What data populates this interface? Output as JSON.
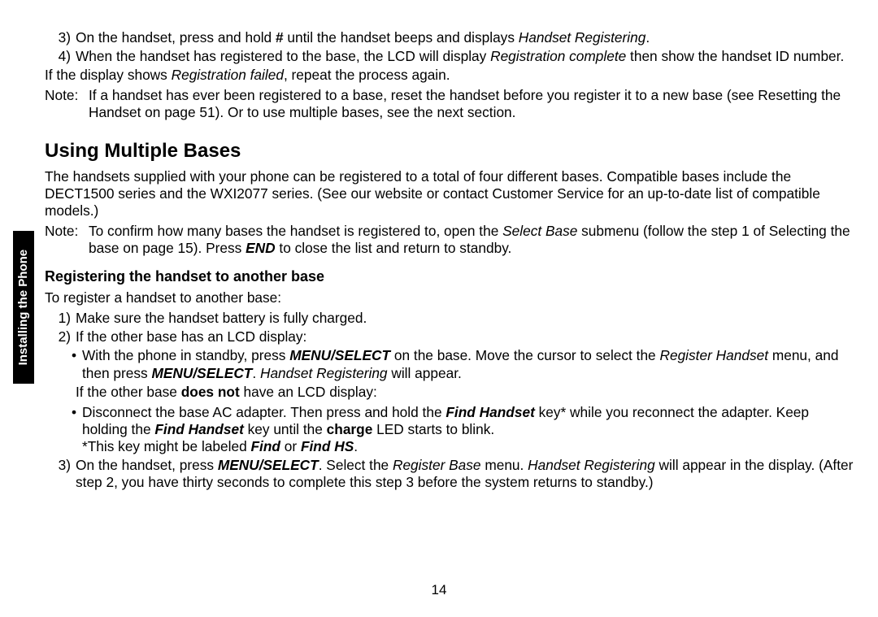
{
  "sideTab": "Installing the Phone",
  "topList": {
    "item3": {
      "marker": "3)",
      "pre": "On the handset, press and hold ",
      "key": "#",
      "mid": " until the handset beeps and displays ",
      "em": "Handset Registering",
      "post": "."
    },
    "item4": {
      "marker": "4)",
      "pre": "When the handset has registered to the base, the LCD will display ",
      "em": "Registration complete",
      "post": " then show the handset ID number."
    }
  },
  "failLine": {
    "pre": "If the display shows ",
    "em": "Registration failed",
    "post": ", repeat the process again."
  },
  "note1": {
    "label": "Note:",
    "text": "If a handset has ever been registered to a base, reset the handset before you register it to a new base (see Resetting the Handset on page 51). Or to use multiple bases, see the next section."
  },
  "sectionTitle": "Using Multiple Bases",
  "sectionBody": "The handsets supplied with your phone can be registered to a total of four different bases. Compatible bases include the DECT1500 series and the WXI2077 series. (See our website or contact Customer Service for an up-to-date list of compatible models.)",
  "note2": {
    "label": "Note:",
    "pre": "To confirm how many bases the handset is registered to, open the ",
    "em1": "Select Base",
    "mid": " submenu (follow the step 1 of Selecting the base on page 15). Press ",
    "bold": "END",
    "post": " to close the list and return to standby."
  },
  "subTitle": "Registering the handset to another base",
  "intro2": "To register a handset to another base:",
  "steps": {
    "s1": {
      "marker": "1)",
      "text": "Make sure the handset battery is fully charged."
    },
    "s2": {
      "marker": "2)",
      "text": "If the other base has an LCD display:"
    },
    "bullet1": {
      "dot": "•",
      "pre": "With the phone in standby, press ",
      "b1": "MENU/SELECT",
      "mid1": " on the base. Move the cursor to select the ",
      "em1": "Register Handset",
      "mid2": " menu, and then press ",
      "b2": "MENU/SELECT",
      "mid3": ". ",
      "em2": "Handset Registering",
      "post": " will appear."
    },
    "noLcd": {
      "pre": "If the other base ",
      "b": "does not",
      "post": " have an LCD display:"
    },
    "bullet2": {
      "dot": "•",
      "pre": "Disconnect the base AC adapter. Then press and hold the ",
      "b1": "Find Handset",
      "mid1": " key* while you reconnect the adapter. Keep holding the ",
      "b2": "Find Handset",
      "mid2": " key until the ",
      "b3": "charge",
      "post": " LED starts to blink.",
      "foot_pre": "*This key might be labeled ",
      "foot_b1": "Find",
      "foot_mid": " or ",
      "foot_b2": "Find HS",
      "foot_post": "."
    },
    "s3": {
      "marker": "3)",
      "pre": "On the handset, press ",
      "b1": "MENU/SELECT",
      "mid1": ". Select the ",
      "em1": "Register Base",
      "mid2": " menu. ",
      "em2": "Handset Registering",
      "post": " will appear in the display. (After step 2, you have thirty seconds to complete this step 3 before the system returns to standby.)"
    }
  },
  "pageNo": "14"
}
